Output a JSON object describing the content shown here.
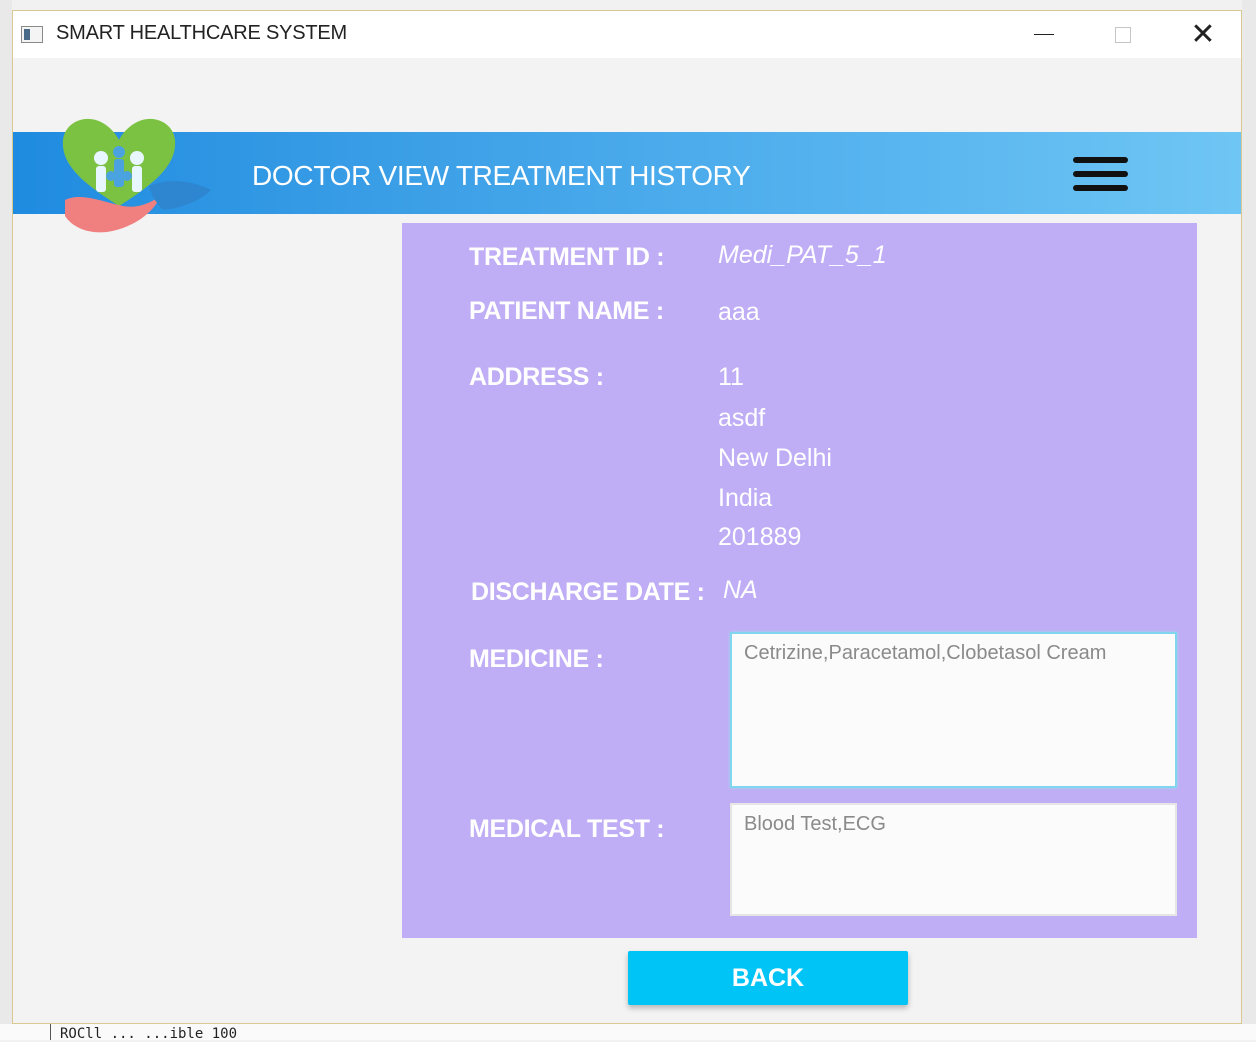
{
  "window": {
    "title": "SMART HEALTHCARE SYSTEM",
    "minimize": "minimize",
    "maximize": "maximize",
    "close": "✕"
  },
  "header": {
    "title": "DOCTOR VIEW TREATMENT HISTORY",
    "menu_icon": "hamburger-menu-icon",
    "gradient": [
      "#1f8be0",
      "#6fc6f4"
    ]
  },
  "details": {
    "treatment_id_label": "TREATMENT ID :",
    "treatment_id": "Medi_PAT_5_1",
    "patient_name_label": "PATIENT NAME :",
    "patient_name": "aaa",
    "address_label": "ADDRESS :",
    "address_lines": [
      "11",
      "asdf",
      "New Delhi",
      "India",
      "201889"
    ],
    "discharge_date_label": "DISCHARGE DATE :",
    "discharge_date": "NA",
    "medicine_label": "MEDICINE :",
    "medicine": "Cetrizine,Paracetamol,Clobetasol Cream",
    "medical_test_label": "MEDICAL TEST :",
    "medical_test": "Blood Test,ECG"
  },
  "back_button": "BACK",
  "colors": {
    "card": "#bfadf5",
    "button": "#00c4f5"
  },
  "background_text": "ROCll    ...    ...ible 100"
}
